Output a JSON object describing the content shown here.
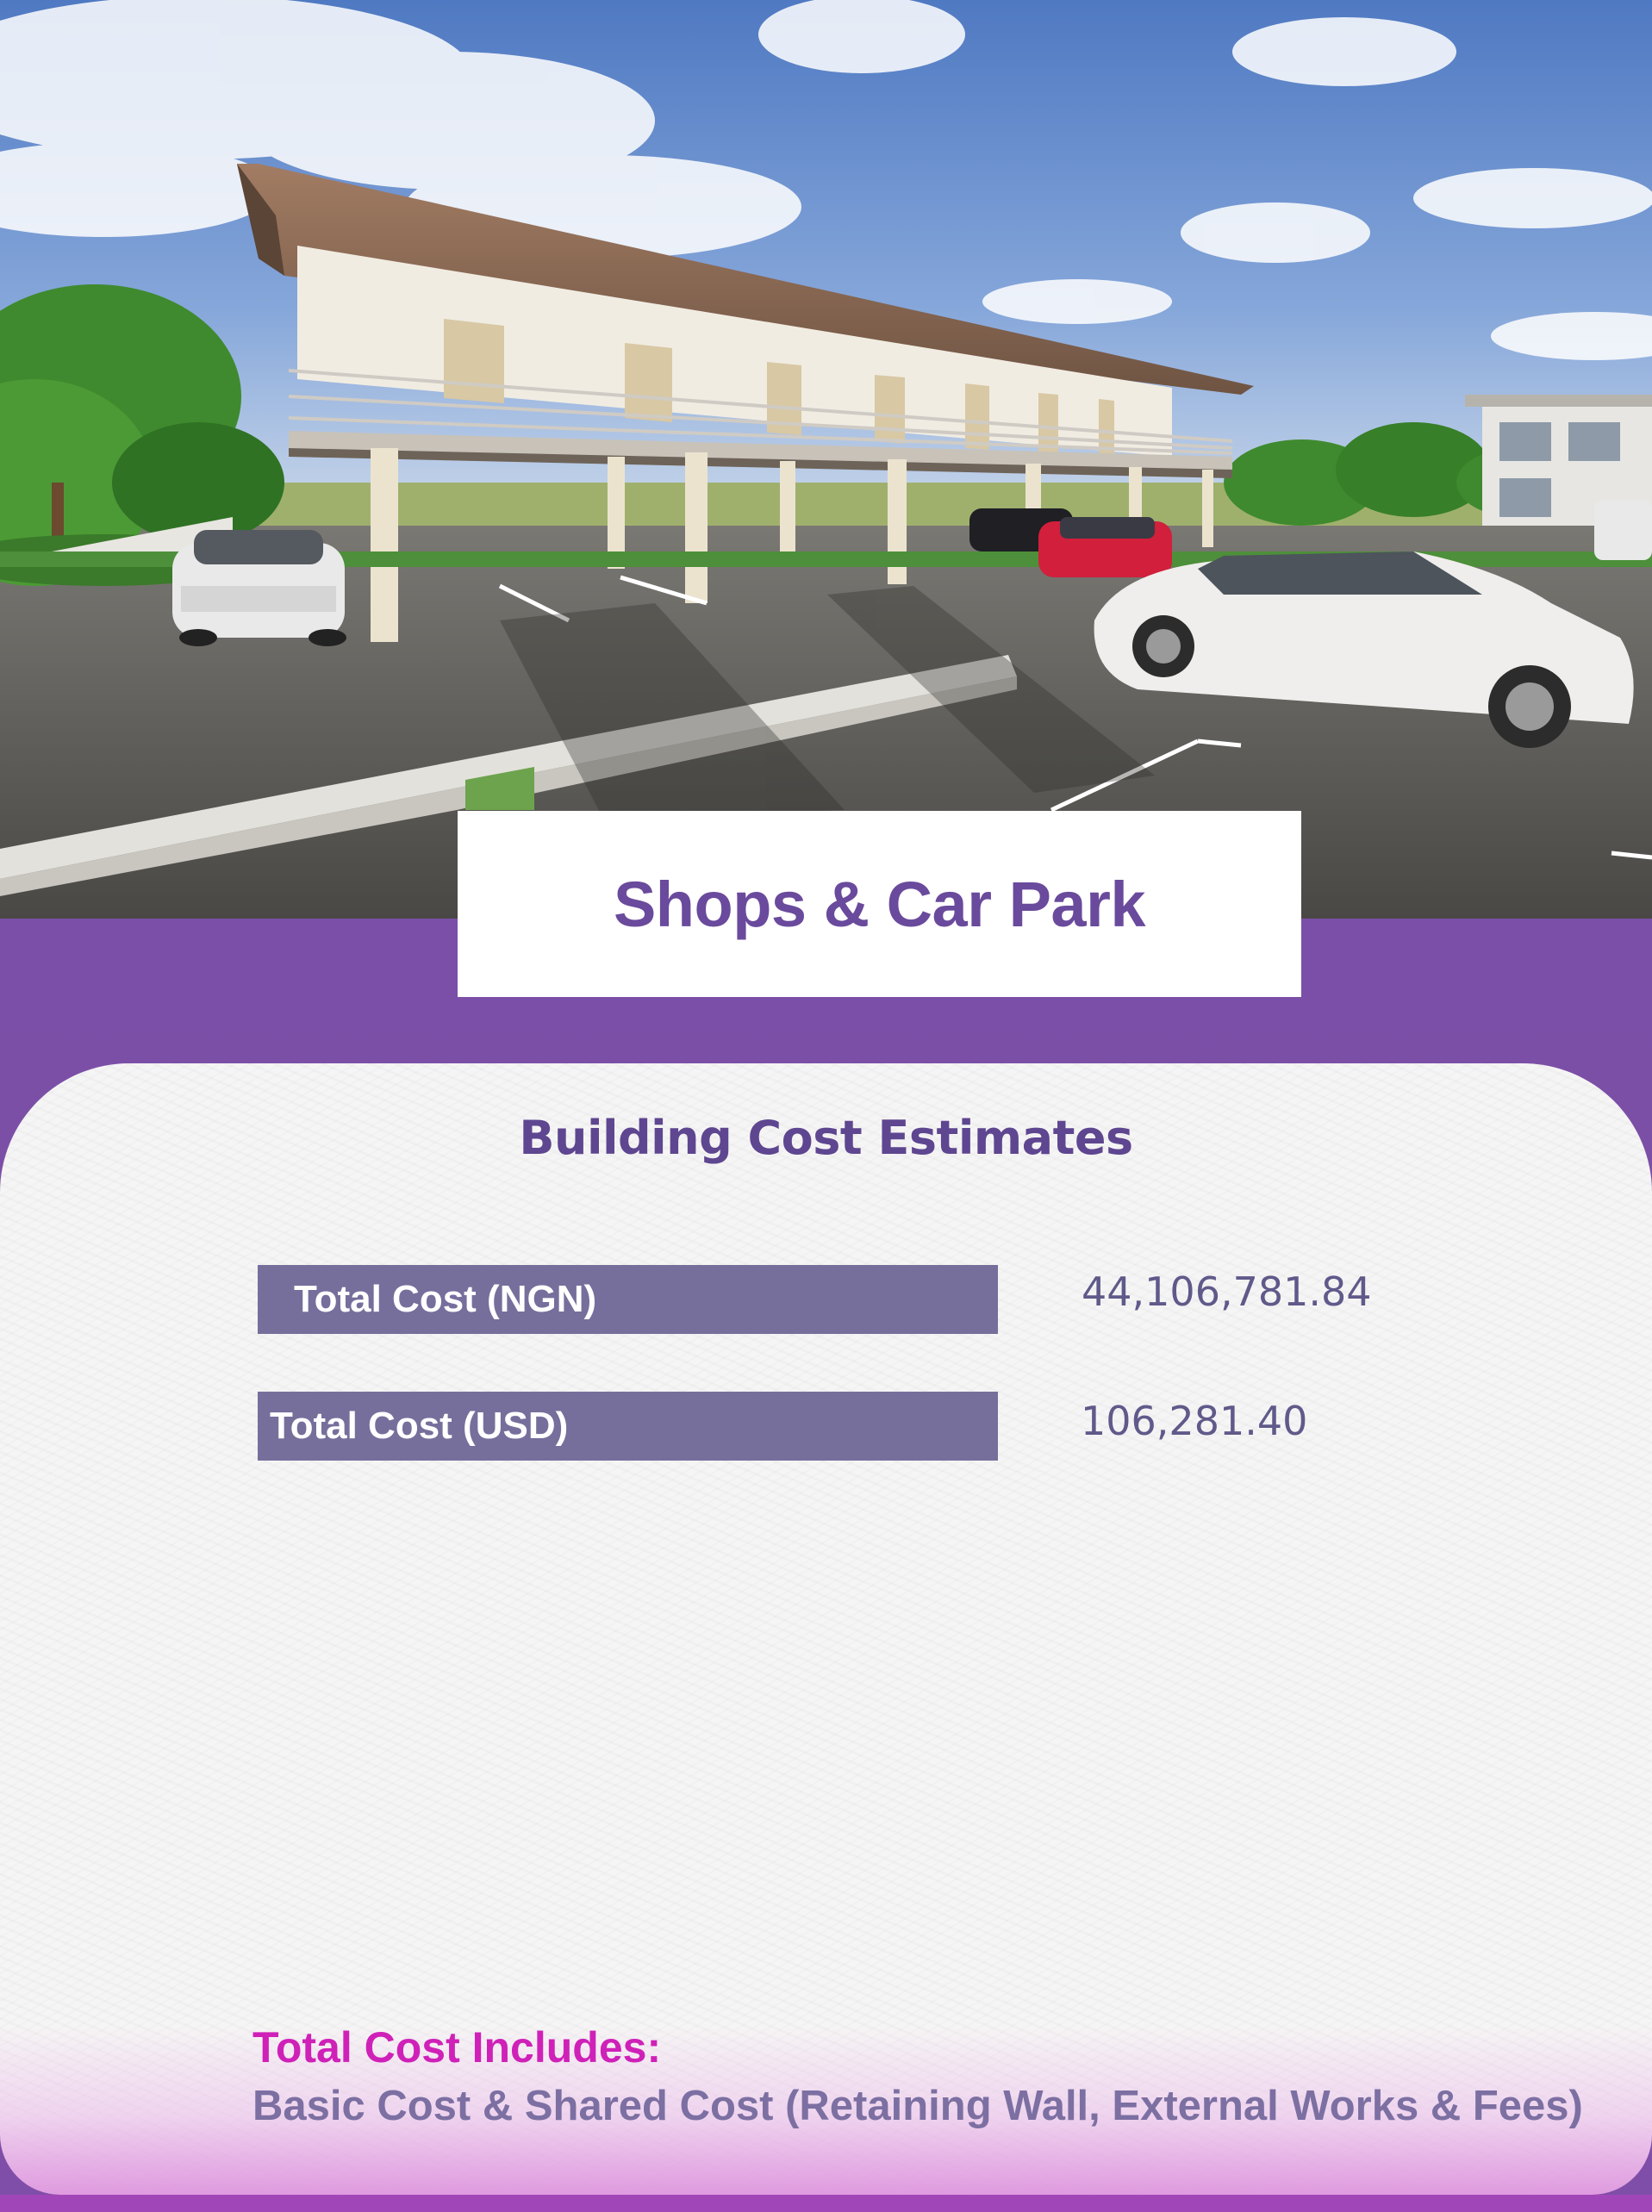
{
  "hero": {
    "alt_description_hidden": ""
  },
  "title": "Shops & Car Park",
  "card": {
    "heading": "Building Cost Estimates",
    "costs": [
      {
        "label": "Total Cost (NGN)",
        "value": "44,106,781.84"
      },
      {
        "label": "Total Cost (USD)",
        "value": "106,281.40"
      }
    ],
    "includes_title": "Total Cost Includes:",
    "includes_body": "Basic Cost & Shared Cost (Retaining Wall, External Works & Fees)"
  },
  "colors": {
    "brand_purple": "#7b4fa7",
    "title_text": "#6a4a9c",
    "label_bar": "#766f9c",
    "magenta_accent": "#cf21b8"
  }
}
